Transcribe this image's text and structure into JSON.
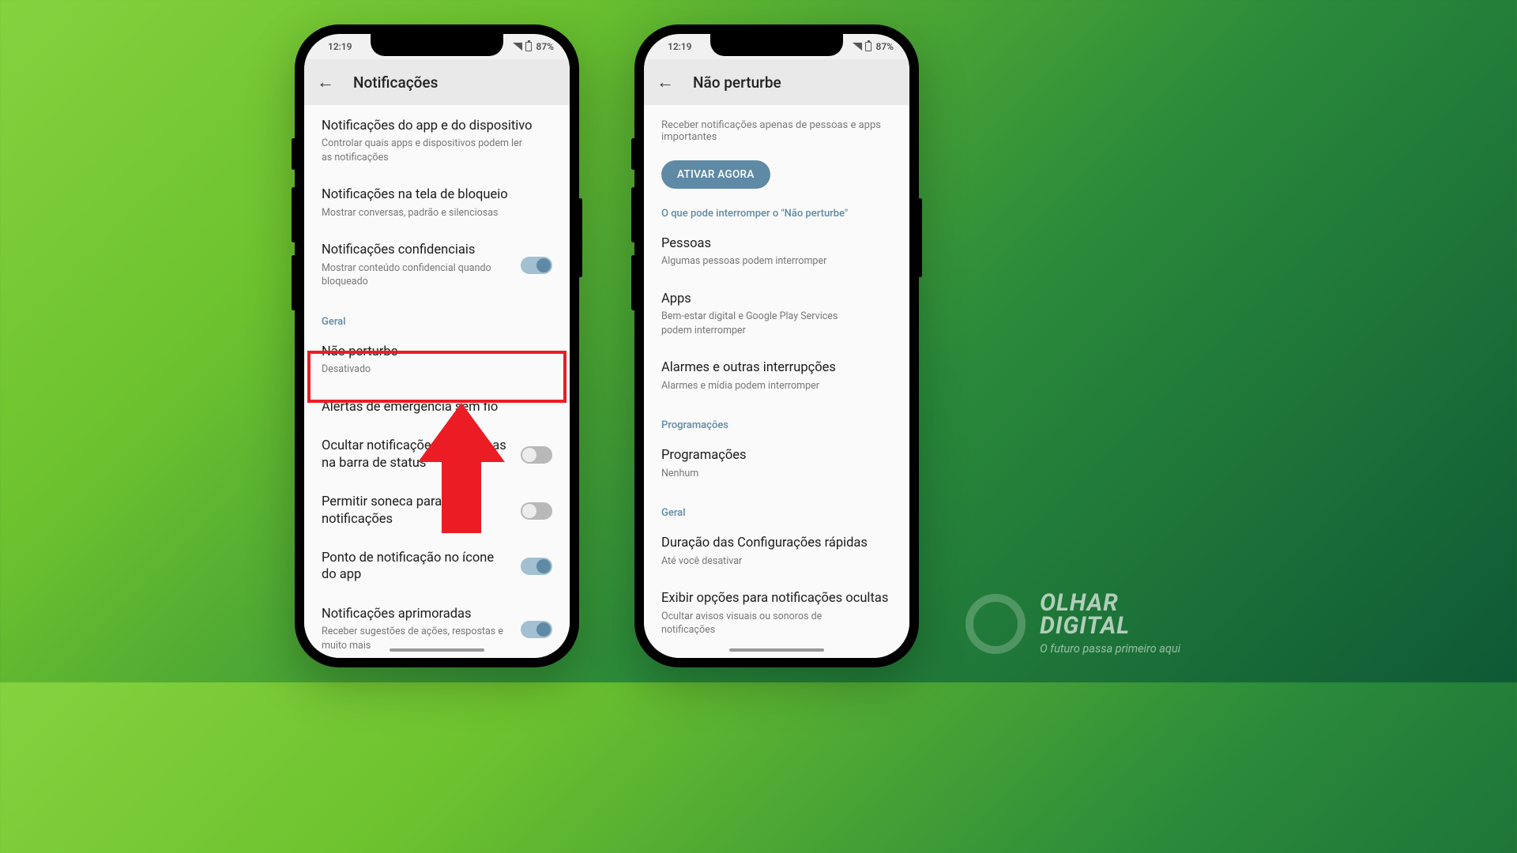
{
  "status": {
    "time": "12:19",
    "battery": "87%"
  },
  "phone1": {
    "header": "Notificações",
    "items": {
      "appdev": {
        "title": "Notificações do app e do dispositivo",
        "sub": "Controlar quais apps e dispositivos podem ler as notificações"
      },
      "lock": {
        "title": "Notificações na tela de bloqueio",
        "sub": "Mostrar conversas, padrão e silenciosas"
      },
      "conf": {
        "title": "Notificações confidenciais",
        "sub": "Mostrar conteúdo confidencial quando bloqueado"
      }
    },
    "section_general": "Geral",
    "dnd": {
      "title": "Não perturbe",
      "sub": "Desativado"
    },
    "alerts": {
      "title": "Alertas de emergência sem fio"
    },
    "hide": {
      "title": "Ocultar notificações silenciosas na barra de status"
    },
    "snooze": {
      "title": "Permitir soneca para notificações"
    },
    "dot": {
      "title": "Ponto de notificação no ícone do app"
    },
    "enhanced": {
      "title": "Notificações aprimoradas",
      "sub": "Receber sugestões de ações, respostas e muito mais"
    }
  },
  "phone2": {
    "header": "Não perturbe",
    "desc": "Receber notificações apenas de pessoas e apps importantes",
    "cta": "ATIVAR AGORA",
    "section_interrupt": "O que pode interromper o \"Não perturbe\"",
    "people": {
      "title": "Pessoas",
      "sub": "Algumas pessoas podem interromper"
    },
    "apps": {
      "title": "Apps",
      "sub": "Bem-estar digital e Google Play Services podem interromper"
    },
    "alarms": {
      "title": "Alarmes e outras interrupções",
      "sub": "Alarmes e mídia podem interromper"
    },
    "section_sched": "Programações",
    "sched": {
      "title": "Programações",
      "sub": "Nenhum"
    },
    "section_general": "Geral",
    "qs": {
      "title": "Duração das Configurações rápidas",
      "sub": "Até você desativar"
    },
    "hidden": {
      "title": "Exibir opções para notificações ocultas",
      "sub": "Ocultar avisos visuais ou sonoros de notificações"
    }
  },
  "watermark": {
    "brand1": "OLHAR",
    "brand2": "DIGITAL",
    "tag": "O futuro passa primeiro aqui"
  }
}
